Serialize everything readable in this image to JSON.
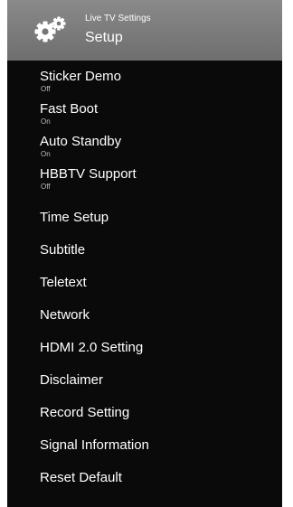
{
  "header": {
    "icon": "gear-icon",
    "subtitle": "Live TV Settings",
    "title": "Setup"
  },
  "menu": {
    "items": [
      {
        "label": "Sticker Demo",
        "value": "Off"
      },
      {
        "label": "Fast Boot",
        "value": "On"
      },
      {
        "label": "Auto Standby",
        "value": "On"
      },
      {
        "label": "HBBTV Support",
        "value": "Off"
      },
      {
        "label": "Time Setup"
      },
      {
        "label": "Subtitle"
      },
      {
        "label": "Teletext"
      },
      {
        "label": "Network"
      },
      {
        "label": "HDMI 2.0 Setting"
      },
      {
        "label": "Disclaimer"
      },
      {
        "label": "Record Setting"
      },
      {
        "label": "Signal Information"
      },
      {
        "label": "Reset Default"
      }
    ]
  },
  "colors": {
    "panel_background": "#0a0a0a",
    "header_background": "#7b7b7b",
    "text": "#ffffff",
    "secondary_text": "#bdbdbd"
  }
}
